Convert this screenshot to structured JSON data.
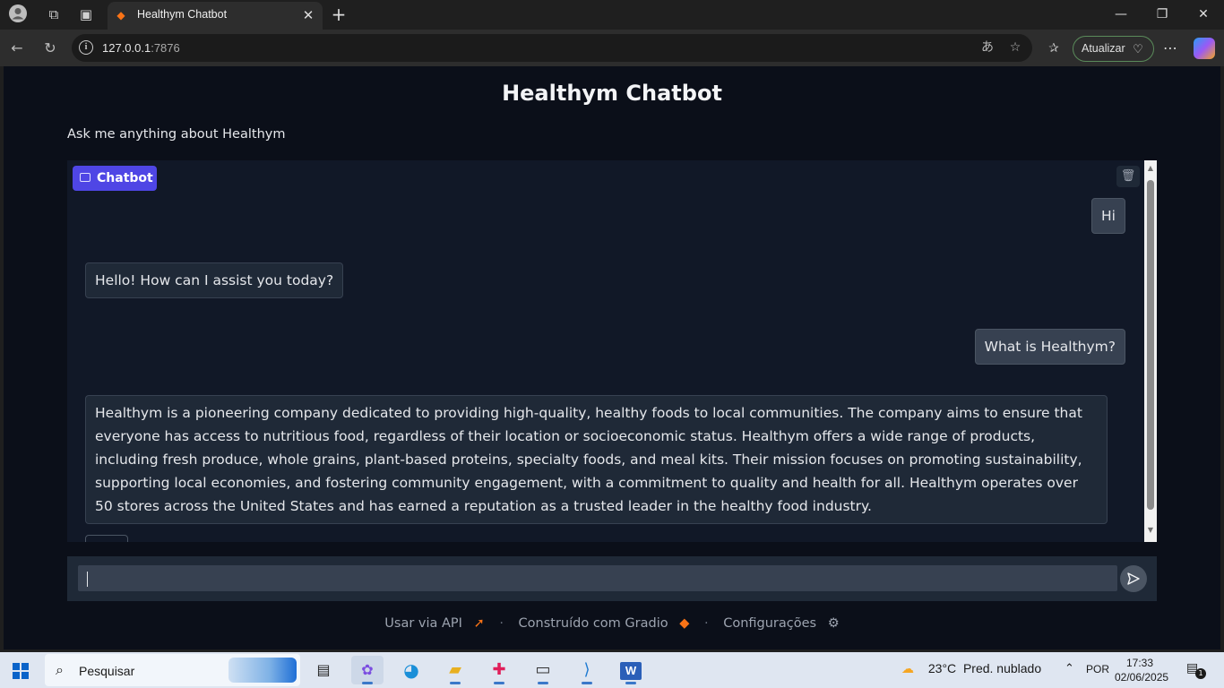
{
  "browser": {
    "tab_title": "Healthym Chatbot",
    "url_host": "127.0.0.1",
    "url_port": ":7876",
    "update_label": "Atualizar"
  },
  "app": {
    "title": "Healthym Chatbot",
    "description": "Ask me anything about Healthym",
    "chatbot_label": "Chatbot",
    "input_value": "",
    "messages": [
      {
        "role": "user",
        "text": "Hi"
      },
      {
        "role": "bot",
        "text": "Hello! How can I assist you today?"
      },
      {
        "role": "user",
        "text": "What is Healthym?"
      },
      {
        "role": "bot",
        "text": "Healthym is a pioneering company dedicated to providing high-quality, healthy foods to local communities. The company aims to ensure that everyone has access to nutritious food, regardless of their location or socioeconomic status. Healthym offers a wide range of products, including fresh produce, whole grains, plant-based proteins, specialty foods, and meal kits. Their mission focuses on promoting sustainability, supporting local economies, and fostering community engagement, with a commitment to quality and health for all. Healthym operates over 50 stores across the United States and has earned a reputation as a trusted leader in the healthy food industry."
      }
    ]
  },
  "footer": {
    "api_label": "Usar via API",
    "built_label": "Construído com Gradio",
    "settings_label": "Configurações",
    "separator": "·"
  },
  "taskbar": {
    "search_placeholder": "Pesquisar",
    "temperature": "23°C",
    "weather": "Pred. nublado",
    "language": "POR",
    "time": "17:33",
    "date": "02/06/2025",
    "notification_count": "1"
  },
  "colors": {
    "page_bg": "#0b0f19",
    "panel_bg": "#111827",
    "accent": "#4f46e5",
    "message_bg": "#1f2937"
  }
}
